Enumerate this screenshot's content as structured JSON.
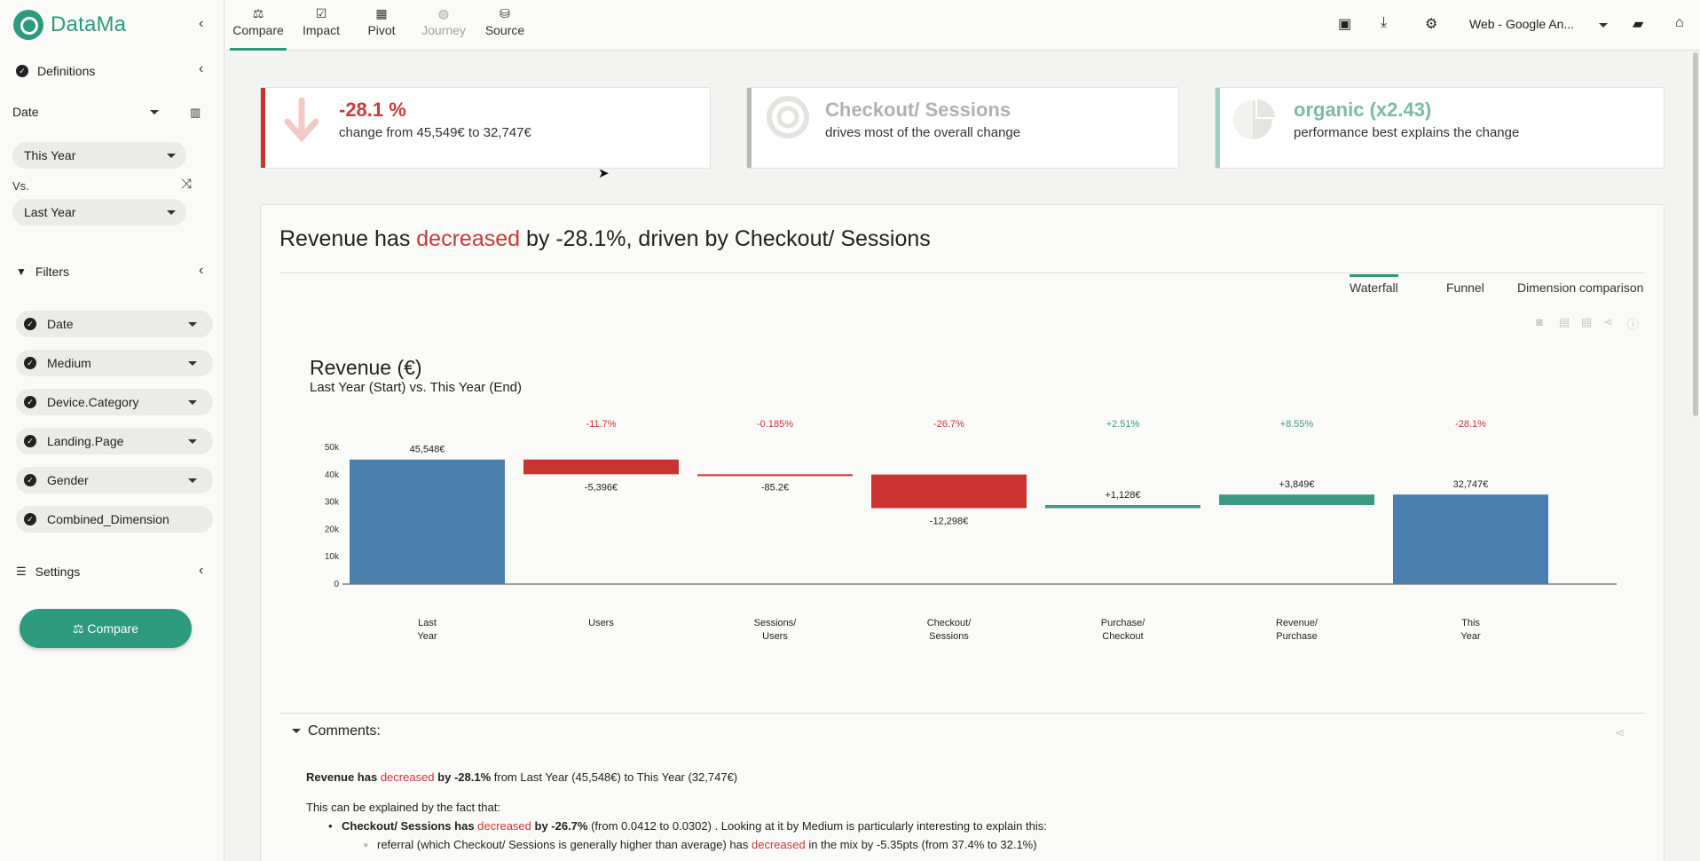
{
  "app": {
    "name": "DataMa"
  },
  "sidebar": {
    "definitions_label": "Definitions",
    "date_label": "Date",
    "period": "This Year",
    "vs_label": "Vs.",
    "comparison": "Last Year",
    "filters_label": "Filters",
    "filters": [
      "Date",
      "Medium",
      "Device.Category",
      "Landing.Page",
      "Gender",
      "Combined_Dimension"
    ],
    "settings_label": "Settings",
    "compare_button": "Compare"
  },
  "topbar": {
    "tabs": [
      "Compare",
      "Impact",
      "Pivot",
      "Journey",
      "Source"
    ],
    "datasource": "Web - Google An..."
  },
  "kpis": [
    {
      "big": "-28.1 %",
      "small": "change from 45,549€ to 32,747€"
    },
    {
      "big": "Checkout/ Sessions",
      "small": "drives most of the overall change"
    },
    {
      "big": "organic (x2.43)",
      "small": "performance best explains the change"
    }
  ],
  "headline": {
    "pre": "Revenue has ",
    "verb": "decreased",
    "post": " by -28.1%, driven by Checkout/ Sessions"
  },
  "views": [
    "Waterfall",
    "Funnel",
    "Dimension comparison"
  ],
  "colors": {
    "accent": "#2d9a7e",
    "negative": "#cc3333",
    "positive": "#3a9a86",
    "total": "#4a7fad"
  },
  "chart_data": {
    "type": "bar",
    "subtype": "waterfall",
    "title": "Revenue (€)",
    "subtitle": "Last Year (Start) vs. This Year (End)",
    "categories": [
      "Last\nYear",
      "Users",
      "Sessions/\nUsers",
      "Checkout/\nSessions",
      "Purchase/\nCheckout",
      "Revenue/\nPurchase",
      "This\nYear"
    ],
    "values": [
      45548,
      -5396,
      -85.2,
      -12298,
      1128,
      3849,
      32747
    ],
    "labels": [
      "45,548€",
      "-5,396€",
      "-85.2€",
      "-12,298€",
      "+1,128€",
      "+3,849€",
      "32,747€"
    ],
    "pct_labels": [
      "",
      "-11.7%",
      "-0.185%",
      "-26.7%",
      "+2.51%",
      "+8.55%",
      "-28.1%"
    ],
    "bar_kind": [
      "total",
      "neg",
      "neg",
      "neg",
      "pos",
      "pos",
      "total"
    ],
    "y_ticks": [
      "0",
      "10k",
      "20k",
      "30k",
      "40k",
      "50k"
    ],
    "ylim": [
      0,
      50000
    ]
  },
  "comments": {
    "title": "Comments:",
    "line1": {
      "a": "Revenue has ",
      "b": "decreased",
      "c": " by -28.1%",
      "d": " from Last Year (45,548€) to This Year (32,747€)"
    },
    "line2": "This can be explained by the fact that:",
    "line3": {
      "a": "Checkout/ Sessions has ",
      "b": "decreased",
      "c": " by -26.7%",
      "d": " (from 0.0412 to 0.0302) . Looking at it by Medium is particularly interesting to explain this:"
    },
    "line4": {
      "a": "referral (which Checkout/ Sessions is generally higher than average) has ",
      "b": "decreased",
      "c": " in the mix by -5.35pts (from 37.4% to 32.1%)"
    }
  }
}
